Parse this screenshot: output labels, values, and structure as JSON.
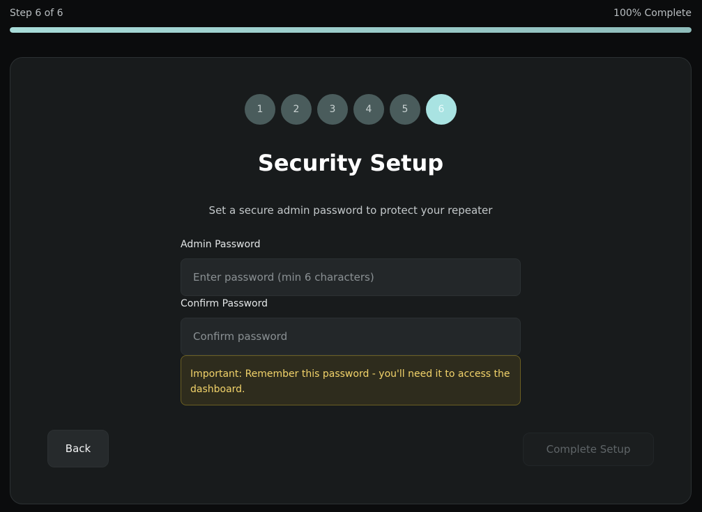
{
  "progress": {
    "step_text": "Step 6 of 6",
    "percent_text": "100% Complete",
    "percent": 100
  },
  "steps": [
    "1",
    "2",
    "3",
    "4",
    "5",
    "6"
  ],
  "active_step": 6,
  "page": {
    "title": "Security Setup",
    "subtitle": "Set a secure admin password to protect your repeater"
  },
  "form": {
    "admin_password": {
      "label": "Admin Password",
      "placeholder": "Enter password (min 6 characters)",
      "value": ""
    },
    "confirm_password": {
      "label": "Confirm Password",
      "placeholder": "Confirm password",
      "value": ""
    }
  },
  "notice": {
    "text": "Important: Remember this password - you'll need it to access the dashboard."
  },
  "buttons": {
    "back_label": "Back",
    "complete_label": "Complete Setup"
  },
  "colors": {
    "accent": "#a9e3e2",
    "step_inactive": "#4a5c5c",
    "warning_text": "#f2d36a"
  }
}
